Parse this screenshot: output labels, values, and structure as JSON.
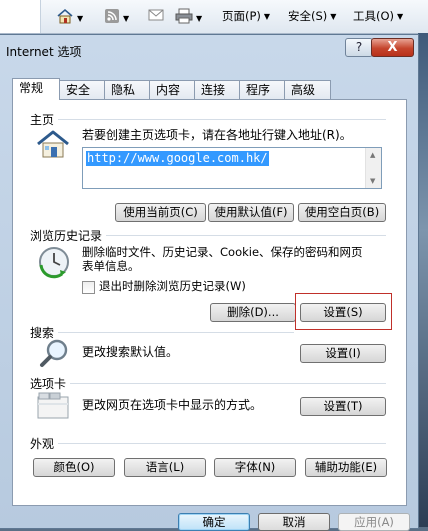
{
  "command_bar": {
    "items": [
      {
        "icon": "home-icon"
      },
      {
        "icon": "rss-feed-icon"
      },
      {
        "icon": "mail-icon"
      },
      {
        "icon": "print-icon"
      },
      {
        "label": "页面(P)"
      },
      {
        "label": "安全(S)"
      },
      {
        "label": "工具(O)"
      }
    ]
  },
  "dialog": {
    "title": "Internet 选项",
    "help_label": "?",
    "close_label": "X",
    "tabs": [
      "常规",
      "安全",
      "隐私",
      "内容",
      "连接",
      "程序",
      "高级"
    ],
    "active_tab": "常规"
  },
  "home_page": {
    "section": "主页",
    "instruction": "若要创建主页选项卡，请在各地址行键入地址(R)。",
    "url": "http://www.google.com.hk/",
    "buttons": [
      "使用当前页(C)",
      "使用默认值(F)",
      "使用空白页(B)"
    ]
  },
  "history": {
    "section": "浏览历史记录",
    "description_line1": "删除临时文件、历史记录、Cookie、保存的密码和网页",
    "description_line2": "表单信息。",
    "checkbox_label": "退出时删除浏览历史记录(W)",
    "delete_button": "删除(D)...",
    "settings_button": "设置(S)"
  },
  "search": {
    "section": "搜索",
    "description": "更改搜索默认值。",
    "settings_button": "设置(I)"
  },
  "tabs_section": {
    "section": "选项卡",
    "description": "更改网页在选项卡中显示的方式。",
    "settings_button": "设置(T)"
  },
  "appearance": {
    "section": "外观",
    "buttons": [
      "颜色(O)",
      "语言(L)",
      "字体(N)",
      "辅助功能(E)"
    ]
  },
  "footer": {
    "ok": "确定",
    "cancel": "取消",
    "apply": "应用(A)"
  }
}
